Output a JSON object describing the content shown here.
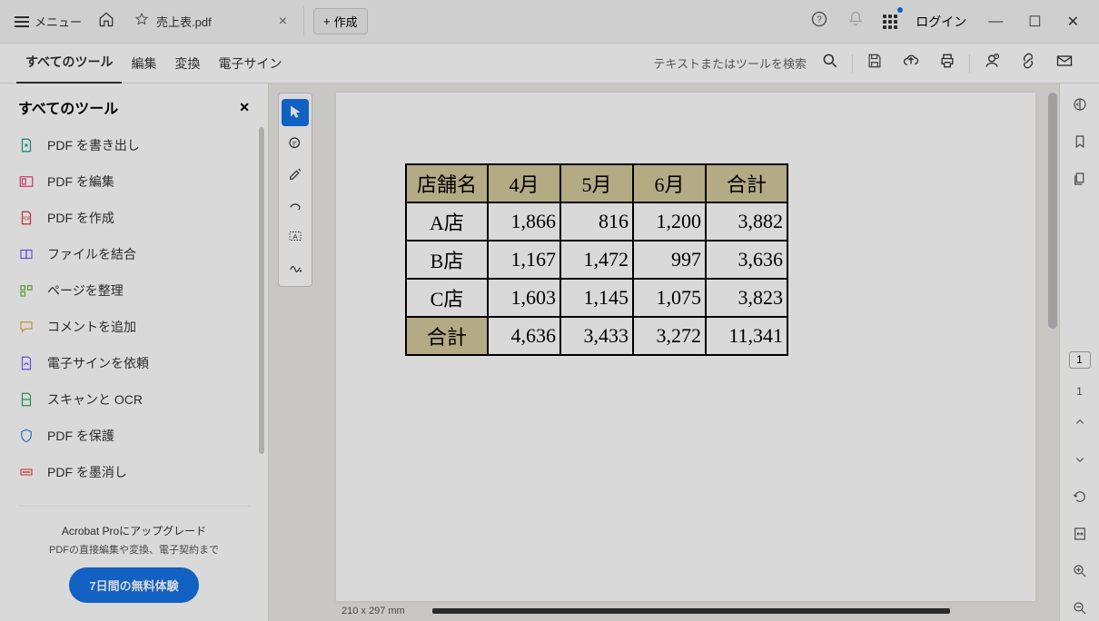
{
  "titleBar": {
    "menu": "メニュー",
    "tabTitle": "売上表.pdf",
    "create": "作成",
    "login": "ログイン"
  },
  "toolbar": {
    "tabs": [
      "すべてのツール",
      "編集",
      "変換",
      "電子サイン"
    ],
    "searchPlaceholder": "テキストまたはツールを検索"
  },
  "sidePanel": {
    "title": "すべてのツール",
    "items": [
      "PDF を書き出し",
      "PDF を編集",
      "PDF を作成",
      "ファイルを結合",
      "ページを整理",
      "コメントを追加",
      "電子サインを依頼",
      "スキャンと OCR",
      "PDF を保護",
      "PDF を墨消し"
    ],
    "upgradeTitle": "Acrobat Proにアップグレード",
    "upgradeSub": "PDFの直接編集や変換、電子契約まで",
    "trialButton": "7日間の無料体験"
  },
  "document": {
    "headers": [
      "店舗名",
      "4月",
      "5月",
      "6月",
      "合計"
    ],
    "rows": [
      {
        "name": "A店",
        "apr": "1,866",
        "may": "816",
        "jun": "1,200",
        "total": "3,882"
      },
      {
        "name": "B店",
        "apr": "1,167",
        "may": "1,472",
        "jun": "997",
        "total": "3,636"
      },
      {
        "name": "C店",
        "apr": "1,603",
        "may": "1,145",
        "jun": "1,075",
        "total": "3,823"
      }
    ],
    "totalRow": {
      "name": "合計",
      "apr": "4,636",
      "may": "3,433",
      "jun": "3,272",
      "total": "11,341"
    }
  },
  "statusBar": {
    "pageSize": "210 x 297 mm"
  },
  "rightRail": {
    "pageBox": "1",
    "pageNum": "1"
  },
  "chart_data": {
    "type": "table",
    "title": "売上表",
    "columns": [
      "店舗名",
      "4月",
      "5月",
      "6月",
      "合計"
    ],
    "rows": [
      [
        "A店",
        1866,
        816,
        1200,
        3882
      ],
      [
        "B店",
        1167,
        1472,
        997,
        3636
      ],
      [
        "C店",
        1603,
        1145,
        1075,
        3823
      ],
      [
        "合計",
        4636,
        3433,
        3272,
        11341
      ]
    ]
  }
}
